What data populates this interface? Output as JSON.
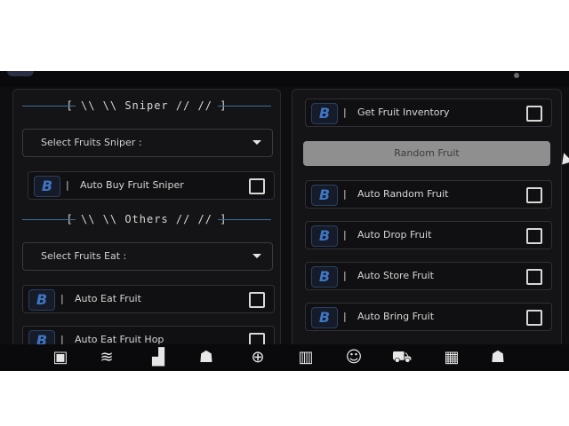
{
  "left": {
    "sniper_header": "[ \\\\ \\\\ Sniper // // ]",
    "sniper_dropdown": {
      "label": "Select Fruits Sniper :"
    },
    "sniper_toggle": {
      "badge": "B",
      "sep": "|",
      "label": "Auto Buy Fruit Sniper",
      "checked": false
    },
    "others_header": "[ \\\\ \\\\ Others // // ]",
    "eat_dropdown": {
      "label": "Select Fruits Eat :"
    },
    "eat_toggle": {
      "badge": "B",
      "sep": "|",
      "label": "Auto Eat Fruit",
      "checked": false
    },
    "partial_toggle": {
      "badge": "B",
      "sep": "|",
      "label": "Auto Eat Fruit Hop",
      "checked": false
    }
  },
  "right": {
    "items": [
      {
        "badge": "B",
        "sep": "|",
        "label": "Get Fruit Inventory",
        "checked": false
      },
      {
        "badge": "B",
        "sep": "|",
        "label": "Auto Random Fruit",
        "checked": false
      },
      {
        "badge": "B",
        "sep": "|",
        "label": "Auto Drop Fruit",
        "checked": false
      },
      {
        "badge": "B",
        "sep": "|",
        "label": "Auto Store Fruit",
        "checked": false
      },
      {
        "badge": "B",
        "sep": "|",
        "label": "Auto Bring Fruit",
        "checked": false
      }
    ],
    "random_button": {
      "label": "Random Fruit"
    }
  },
  "toolbar": {
    "icons": [
      "home-icon",
      "map-scroll-icon",
      "chart-icon",
      "players-icon",
      "target-icon",
      "building-icon",
      "character-face-icon",
      "shop-cart-icon",
      "apps-grid-icon",
      "user-icon"
    ],
    "glyphs": [
      "▣",
      "≋",
      "▟",
      "☗",
      "⊕",
      "▥",
      "☺",
      "⛟",
      "▦",
      "☗"
    ]
  },
  "colors": {
    "accent": "#3f76c3",
    "background": "#0e0e10",
    "button_gray": "#8f8f8f"
  }
}
